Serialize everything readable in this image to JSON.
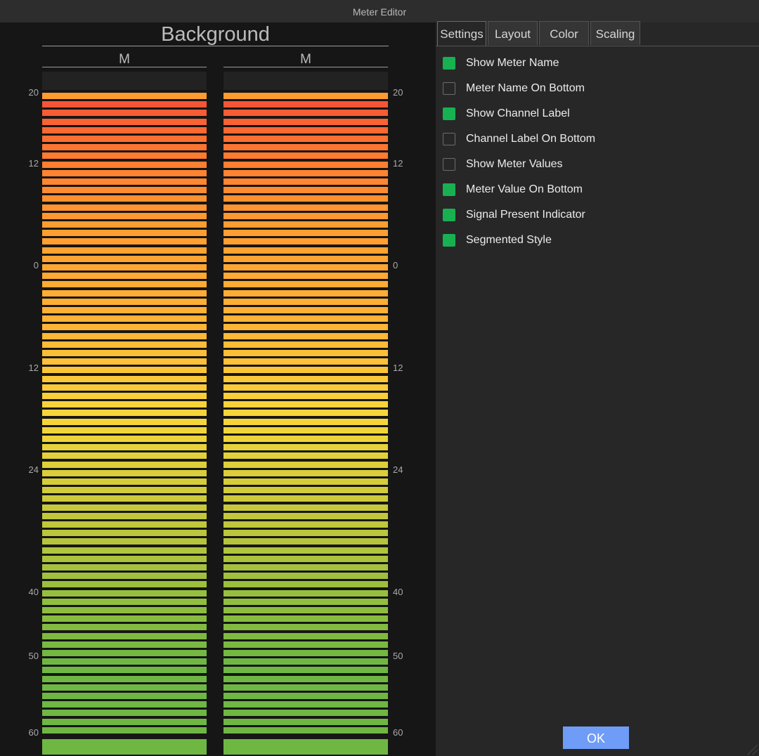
{
  "window": {
    "title": "Meter Editor"
  },
  "preview": {
    "meter_name": "Background",
    "channels": [
      {
        "label": "M"
      },
      {
        "label": "M"
      }
    ],
    "scale_ticks": [
      "20",
      "12",
      "0",
      "12",
      "24",
      "40",
      "50",
      "60"
    ],
    "colors": {
      "top": "#ff9c30",
      "hot": "#f44f36",
      "orange": "#ff7a30",
      "amber": "#ffb436",
      "yellow": "#f7d73a",
      "lime": "#c1c73a",
      "green": "#6fb743"
    }
  },
  "tabs": [
    {
      "label": "Settings",
      "active": true
    },
    {
      "label": "Layout",
      "active": false
    },
    {
      "label": "Color",
      "active": false
    },
    {
      "label": "Scaling",
      "active": false
    }
  ],
  "settings": [
    {
      "label": "Show Meter Name",
      "checked": true
    },
    {
      "label": "Meter Name On Bottom",
      "checked": false
    },
    {
      "label": "Show Channel Label",
      "checked": true
    },
    {
      "label": "Channel Label On Bottom",
      "checked": false
    },
    {
      "label": "Show Meter Values",
      "checked": false
    },
    {
      "label": "Meter Value On Bottom",
      "checked": true
    },
    {
      "label": "Signal Present Indicator",
      "checked": true
    },
    {
      "label": "Segmented Style",
      "checked": true
    }
  ],
  "ok_label": "OK",
  "accent": "#17b152",
  "button_color": "#6f9cf6"
}
